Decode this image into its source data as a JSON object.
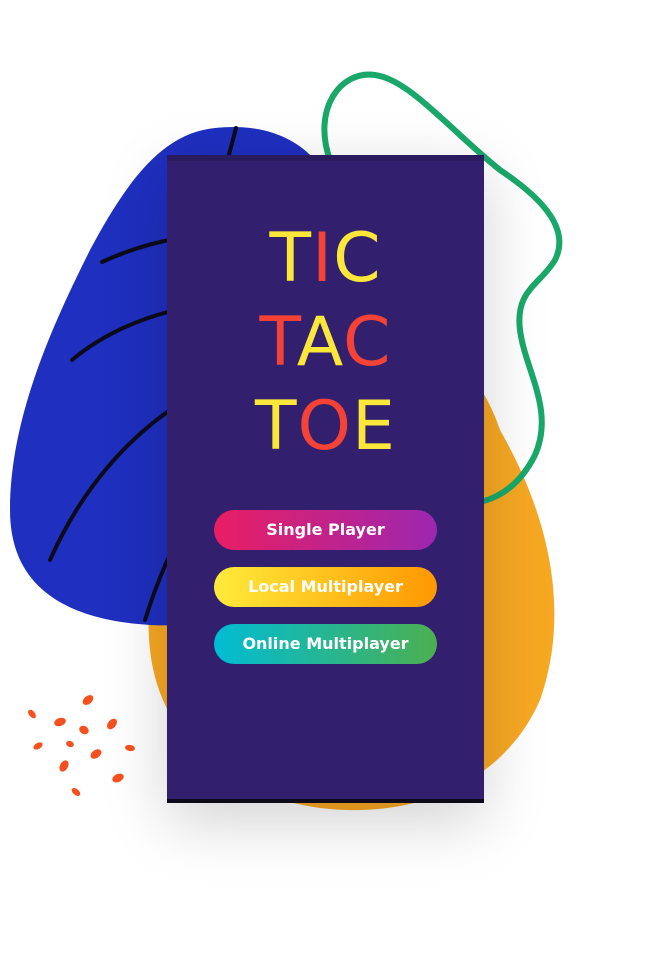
{
  "title": {
    "line1": [
      "T",
      "I",
      "C"
    ],
    "line2": [
      "T",
      "A",
      "C"
    ],
    "line3": [
      "T",
      "O",
      "E"
    ]
  },
  "menu": {
    "single_player": "Single Player",
    "local_multiplayer": "Local Multiplayer",
    "online_multiplayer": "Online Multiplayer"
  },
  "colors": {
    "phone_background": "#32206e",
    "title_yellow": "#fbe73a",
    "title_red": "#f44336",
    "blob_blue": "#1f2fbf",
    "blob_orange": "#f7a823",
    "loop_green": "#1aa86a",
    "confetti_orange": "#f4511e"
  }
}
